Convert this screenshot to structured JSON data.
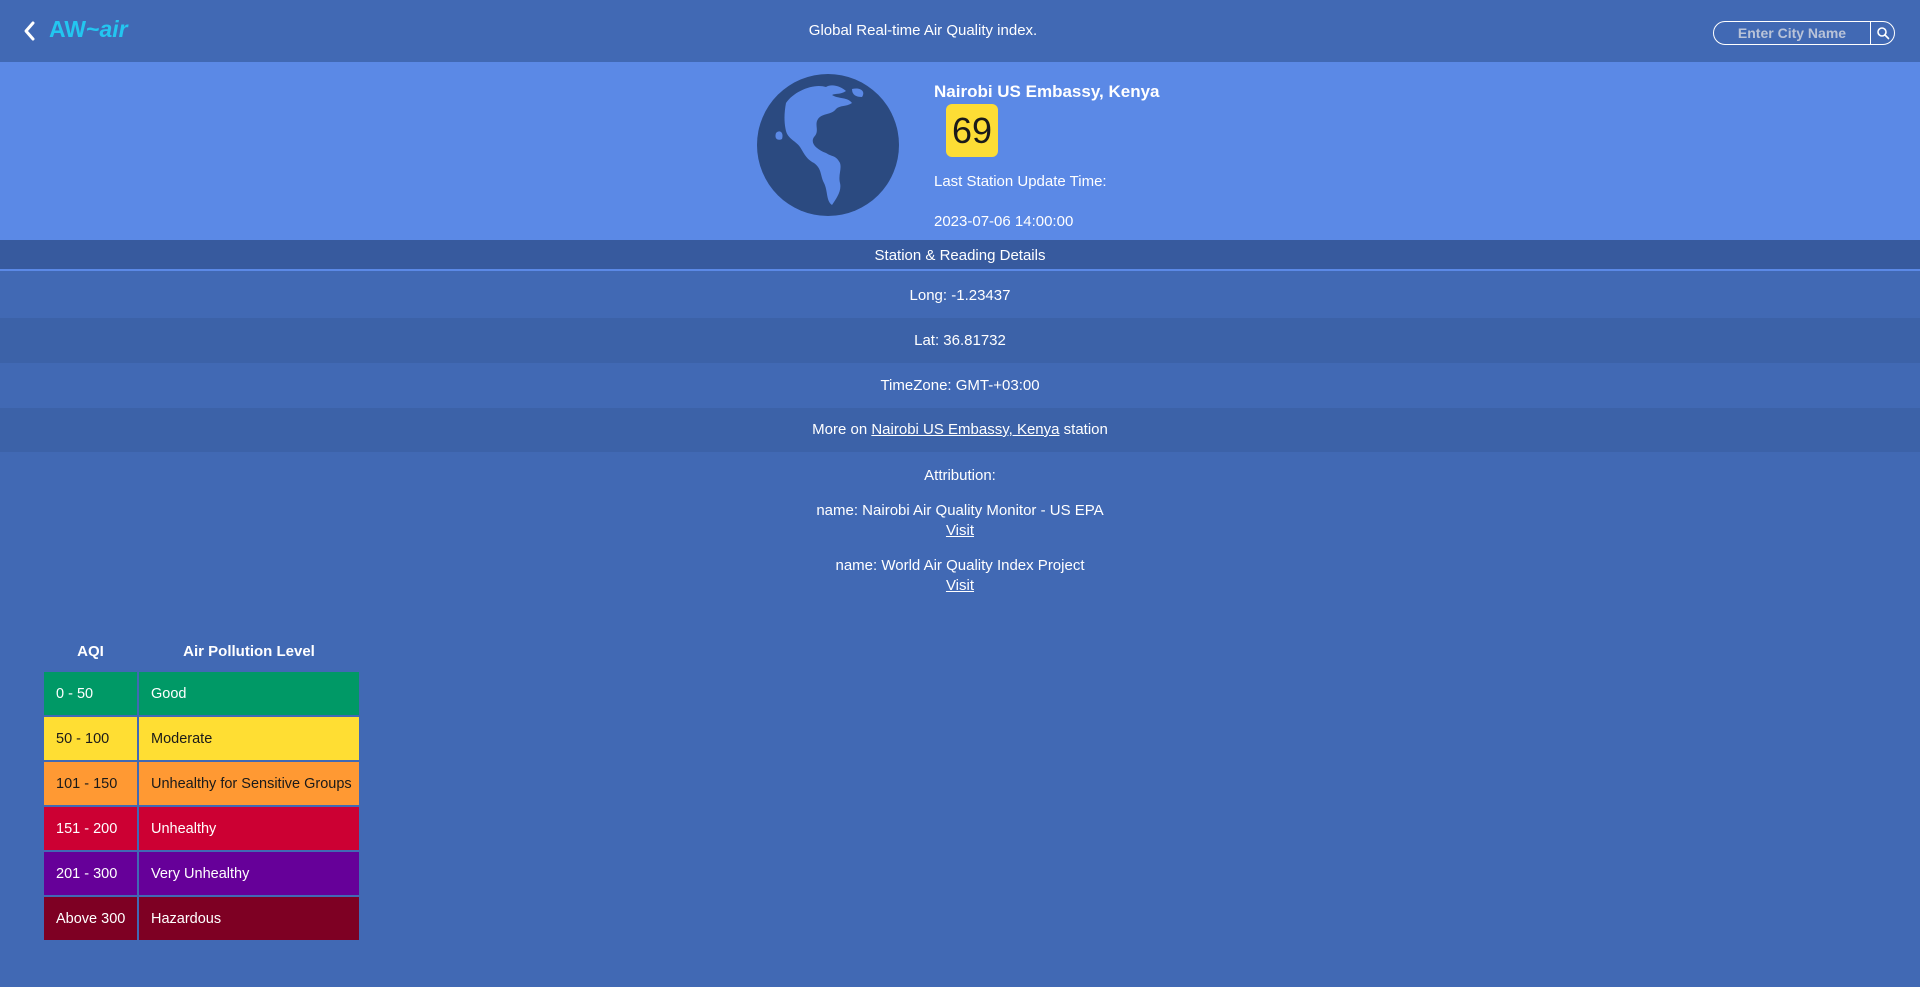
{
  "header": {
    "logo": {
      "prefix": "AW",
      "tilde": "~",
      "suffix": "air"
    },
    "title": "Global Real-time Air Quality index.",
    "search_placeholder": "Enter City Name"
  },
  "station": {
    "name": "Nairobi US Embassy, Kenya",
    "aqi": "69",
    "aqi_color": "#fddd35",
    "update_label": "Last Station Update Time:",
    "update_time": "2023-07-06 14:00:00"
  },
  "details": {
    "header": "Station & Reading Details",
    "long": "Long: -1.23437",
    "lat": "Lat: 36.81732",
    "timezone": "TimeZone: GMT-+03:00",
    "more_prefix": "More on",
    "more_link": "Nairobi US Embassy, Kenya",
    "more_suffix": "station"
  },
  "attribution": {
    "title": "Attribution:",
    "items": [
      {
        "name": "name: Nairobi Air Quality Monitor - US EPA",
        "link": "Visit"
      },
      {
        "name": "name: World Air Quality Index Project",
        "link": "Visit"
      }
    ]
  },
  "legend": {
    "headers": {
      "aqi": "AQI",
      "level": "Air Pollution Level"
    },
    "rows": [
      {
        "range": "0 - 50",
        "level": "Good",
        "color": "#009966",
        "text_color": "#ffffff"
      },
      {
        "range": "50 - 100",
        "level": "Moderate",
        "color": "#ffde33",
        "text_color": "#1a1a1a"
      },
      {
        "range": "101 - 150",
        "level": "Unhealthy for Sensitive Groups",
        "color": "#ff9933",
        "text_color": "#1a1a1a"
      },
      {
        "range": "151 - 200",
        "level": "Unhealthy",
        "color": "#cc0033",
        "text_color": "#ffffff"
      },
      {
        "range": "201 - 300",
        "level": "Very Unhealthy",
        "color": "#660099",
        "text_color": "#ffffff"
      },
      {
        "range": "Above 300",
        "level": "Hazardous",
        "color": "#7e0023",
        "text_color": "#ffffff"
      }
    ]
  }
}
